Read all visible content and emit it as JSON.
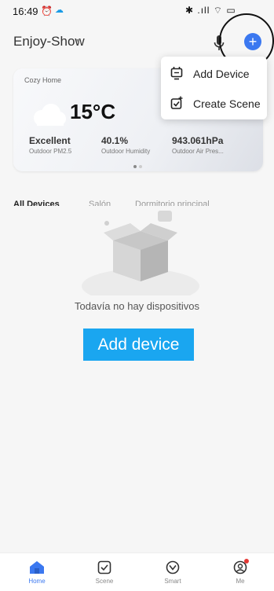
{
  "status_bar": {
    "time": "16:49",
    "alarm_icon": "alarm-icon",
    "cloud_icon": "cloud-notification-icon",
    "right_glyphs": "✱ .ıll ⌔ ▭"
  },
  "header": {
    "title": "Enjoy-Show",
    "caret": "▾",
    "add_symbol": "+"
  },
  "weather": {
    "home_name": "Cozy Home",
    "temperature": "15°C",
    "stats": [
      {
        "value": "Excellent",
        "label": "Outdoor PM2.5"
      },
      {
        "value": "40.1%",
        "label": "Outdoor Humidity"
      },
      {
        "value": "943.061hPa",
        "label": "Outdoor Air Pres..."
      }
    ]
  },
  "popup": {
    "add_device": "Add Device",
    "create_scene": "Create Scene"
  },
  "tabs": [
    "All Devices",
    "Salón",
    "Dormitorio principal"
  ],
  "empty": {
    "message": "Todavía no hay dispositivos",
    "button": "Add device"
  },
  "nav": {
    "home": "Home",
    "scene": "Scene",
    "smart": "Smart",
    "me": "Me"
  },
  "colors": {
    "accent": "#3b78f0",
    "button": "#1aa6f0",
    "badge": "#e53935"
  }
}
